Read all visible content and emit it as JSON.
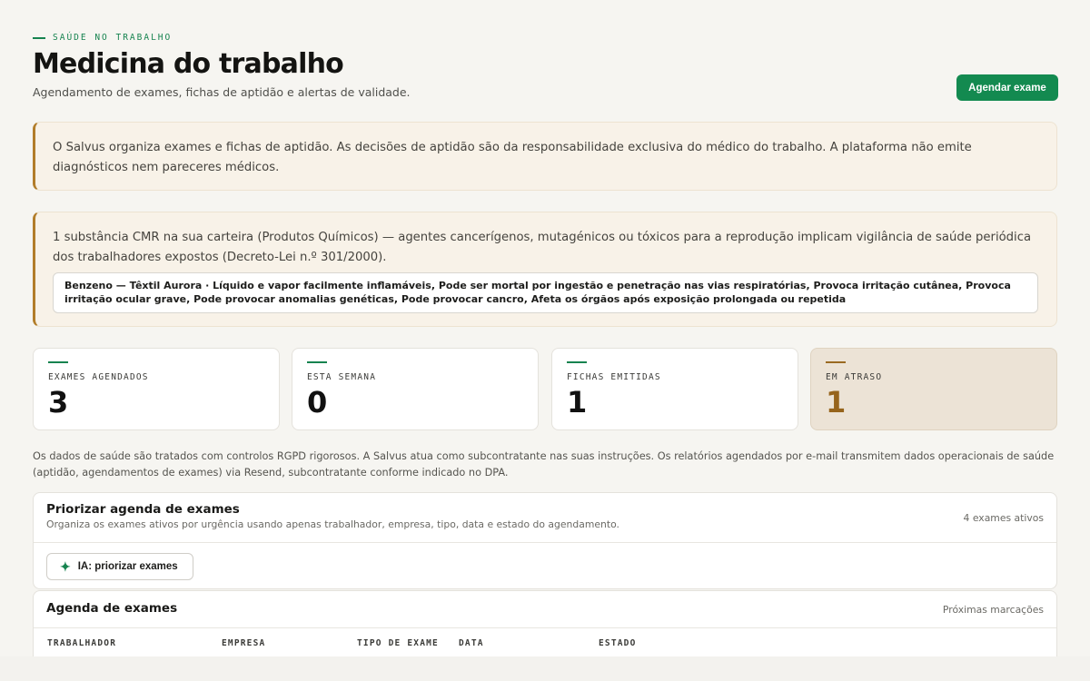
{
  "header": {
    "eyebrow": "SAÚDE NO TRABALHO",
    "title": "Medicina do trabalho",
    "subtitle": "Agendamento de exames, fichas de aptidão e alertas de validade.",
    "primary_action": "Agendar exame"
  },
  "notices": {
    "disclaimer": "O Salvus organiza exames e fichas de aptidão. As decisões de aptidão são da responsabilidade exclusiva do médico do trabalho. A plataforma não emite diagnósticos nem pareceres médicos.",
    "cmr_text": "1 substância CMR na sua carteira (Produtos Químicos) — agentes cancerígenos, mutagénicos ou tóxicos para a reprodução implicam vigilância de saúde periódica dos trabalhadores expostos (Decreto-Lei n.º 301/2000).",
    "cmr_item": "Benzeno — Têxtil Aurora · Líquido e vapor facilmente inflamáveis, Pode ser mortal por ingestão e penetração nas vias respiratórias, Provoca irritação cutânea, Provoca irritação ocular grave, Pode provocar anomalias genéticas, Pode provocar cancro, Afeta os órgãos após exposição prolongada ou repetida"
  },
  "stats": [
    {
      "label": "EXAMES AGENDADOS",
      "value": "3"
    },
    {
      "label": "ESTA SEMANA",
      "value": "0"
    },
    {
      "label": "FICHAS EMITIDAS",
      "value": "1"
    },
    {
      "label": "EM ATRASO",
      "value": "1"
    }
  ],
  "gdpr_note": "Os dados de saúde são tratados com controlos RGPD rigorosos. A Salvus atua como subcontratante nas suas instruções. Os relatórios agendados por e-mail transmitem dados operacionais de saúde (aptidão, agendamentos de exames) via Resend, subcontratante conforme indicado no DPA.",
  "prioritize": {
    "title": "Priorizar agenda de exames",
    "description": "Organiza os exames ativos por urgência usando apenas trabalhador, empresa, tipo, data e estado do agendamento.",
    "count": "4 exames ativos",
    "ai_button": "IA: priorizar exames"
  },
  "agenda": {
    "title": "Agenda de exames",
    "right_label": "Próximas marcações",
    "columns": [
      "TRABALHADOR",
      "EMPRESA",
      "TIPO DE EXAME",
      "DATA",
      "ESTADO"
    ]
  },
  "colors": {
    "accent": "#138a50",
    "warning": "#96641c",
    "notice_border": "#b27d2a"
  },
  "icons": {
    "ai_button_icon": "sparkle-icon"
  }
}
